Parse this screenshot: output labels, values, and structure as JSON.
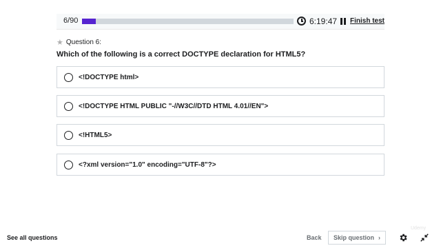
{
  "progress": {
    "text": "6/90",
    "fraction": 0.0667
  },
  "timer": {
    "value": "6:19:47"
  },
  "finish_label": "Finish test",
  "question": {
    "label": "Question 6:",
    "text": "Which of the following is a correct DOCTYPE declaration for HTML5?"
  },
  "options": [
    {
      "text": "<!DOCTYPE html>"
    },
    {
      "text": "<!DOCTYPE HTML PUBLIC \"-//W3C//DTD HTML 4.01//EN\">"
    },
    {
      "text": "<!HTML5>"
    },
    {
      "text": "<?xml version=\"1.0\" encoding=\"UTF-8\"?>"
    }
  ],
  "footer": {
    "see_all": "See all questions",
    "back": "Back",
    "skip": "Skip question",
    "skip_icon": "chevron-right-icon"
  },
  "icons": [
    "clock-icon",
    "pause-icon",
    "star-icon",
    "gear-icon",
    "collapse-icon"
  ],
  "colors": {
    "accent": "#5624d0",
    "text": "#1c1d1f",
    "muted": "#6a6f73",
    "border": "#d1d7dc"
  },
  "watermark": "Udemy"
}
